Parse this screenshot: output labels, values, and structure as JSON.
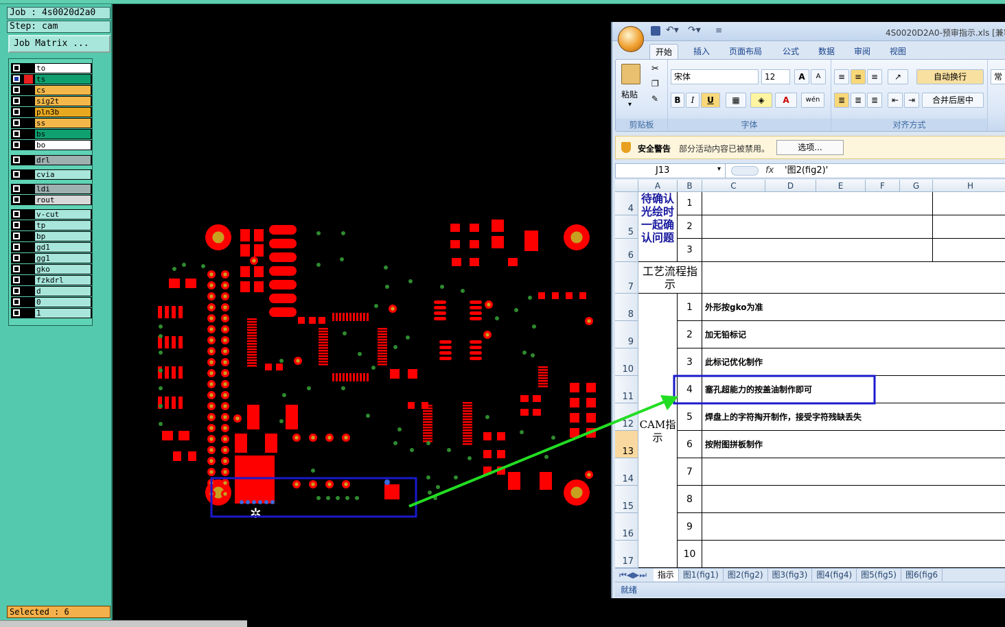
{
  "cam": {
    "job_label": "Job : 4s0020d2a0",
    "step_label": "Step: cam",
    "job_matrix_button": "Job Matrix ...",
    "selected_label": "Selected : 6",
    "layers": [
      {
        "name": "to",
        "color": "#ffffff",
        "checked": false
      },
      {
        "name": "ts",
        "color": "#10a070",
        "checked": true
      },
      {
        "name": "cs",
        "color": "#f4b84a",
        "checked": false
      },
      {
        "name": "sig2t",
        "color": "#f4b84a",
        "checked": false
      },
      {
        "name": "pln3b",
        "color": "#e8a820",
        "checked": false
      },
      {
        "name": "ss",
        "color": "#f4b84a",
        "checked": false
      },
      {
        "name": "bs",
        "color": "#10a070",
        "checked": false
      },
      {
        "name": "bo",
        "color": "#ffffff",
        "checked": false
      },
      {
        "name": "drl",
        "color": "#9eb0b0",
        "checked": false
      },
      {
        "name": "cvia",
        "color": "#a8e6dc",
        "checked": false
      },
      {
        "name": "ldi",
        "color": "#9eb0b0",
        "checked": false
      },
      {
        "name": "rout",
        "color": "#d8d8d8",
        "checked": false
      },
      {
        "name": "v-cut",
        "color": "#a8e6dc",
        "checked": false
      },
      {
        "name": "tp",
        "color": "#a8e6dc",
        "checked": false
      },
      {
        "name": "bp",
        "color": "#a8e6dc",
        "checked": false
      },
      {
        "name": "gd1",
        "color": "#a8e6dc",
        "checked": false
      },
      {
        "name": "gg1",
        "color": "#a8e6dc",
        "checked": false
      },
      {
        "name": "gko",
        "color": "#a8e6dc",
        "checked": false
      },
      {
        "name": "fzkdrl",
        "color": "#a8e6dc",
        "checked": false
      },
      {
        "name": "d",
        "color": "#a8e6dc",
        "checked": false
      },
      {
        "name": "0",
        "color": "#a8e6dc",
        "checked": false
      },
      {
        "name": "1",
        "color": "#a8e6dc",
        "checked": false
      }
    ],
    "colors": {
      "pad": "#ff0000",
      "copper_ring": "#c8a020",
      "via": "#2e8b2e",
      "selection": "#1a1acc",
      "arrow": "#22dd22"
    }
  },
  "excel": {
    "title": "4S0020D2A0-预审指示.xls  [兼容",
    "ribbon_tabs": [
      "开始",
      "插入",
      "页面布局",
      "公式",
      "数据",
      "审阅",
      "视图"
    ],
    "clipboard": {
      "paste": "粘贴",
      "group": "剪贴板"
    },
    "font": {
      "name": "宋体",
      "size": "12",
      "group": "字体",
      "bold": "B",
      "italic": "I",
      "underline": "U",
      "grow": "A",
      "shrink": "A",
      "font_color": "A",
      "phonetic": "wén"
    },
    "alignment": {
      "wrap": "自动换行",
      "merge": "合并后居中",
      "group": "对齐方式"
    },
    "number_format": "常",
    "security": {
      "title": "安全警告",
      "message": "部分活动内容已被禁用。",
      "options_button": "选项..."
    },
    "name_box": "J13",
    "fx": "fx",
    "formula": "'图2(fig2)'",
    "columns": [
      "A",
      "B",
      "C",
      "D",
      "E",
      "F",
      "G",
      "H"
    ],
    "rows": [
      "4",
      "5",
      "6",
      "7",
      "8",
      "9",
      "10",
      "11",
      "12",
      "13",
      "14",
      "15",
      "16",
      "17"
    ],
    "confirm_label": "待确认光绘时一起确认问题",
    "confirm_numbers": [
      "1",
      "2",
      "3"
    ],
    "flow_label": "工艺流程指示",
    "cam_label": "CAM指示",
    "instructions": [
      {
        "no": "1",
        "text": "外形按gko为准"
      },
      {
        "no": "2",
        "text": "加无铅标记"
      },
      {
        "no": "3",
        "text": "此标记优化制作"
      },
      {
        "no": "4",
        "text": "塞孔超能力的按盖油制作即可"
      },
      {
        "no": "5",
        "text": "焊盘上的字符掏开制作，接受字符残缺丢失"
      },
      {
        "no": "6",
        "text": "按附图拼板制作"
      },
      {
        "no": "7",
        "text": ""
      },
      {
        "no": "8",
        "text": ""
      },
      {
        "no": "9",
        "text": ""
      },
      {
        "no": "10",
        "text": ""
      }
    ],
    "sheet_tabs": [
      "指示",
      "图1(fig1)",
      "图2(fig2)",
      "图3(fig3)",
      "图4(fig4)",
      "图5(fig5)",
      "图6(fig6"
    ],
    "active_sheet": "指示",
    "status": "就绪"
  }
}
